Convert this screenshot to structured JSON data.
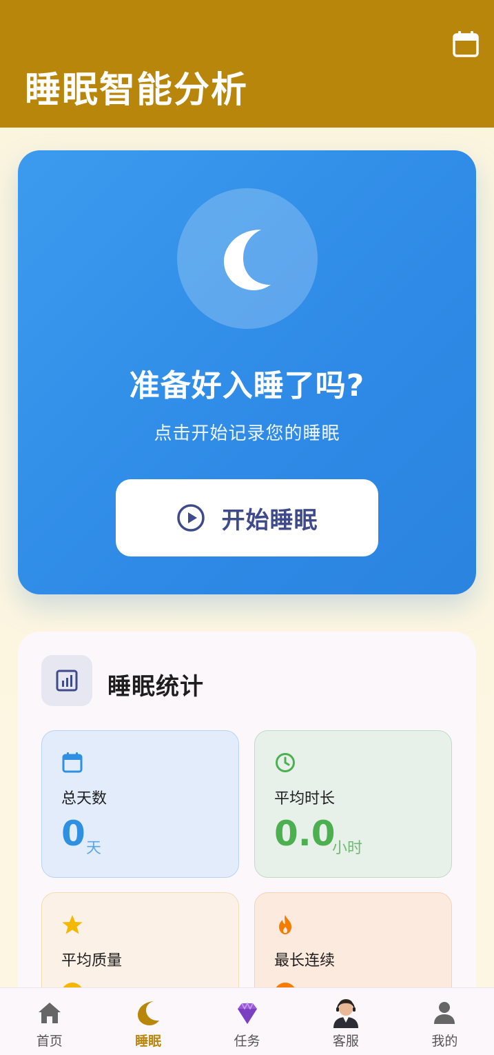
{
  "header": {
    "title": "睡眠智能分析",
    "calendar_icon": "calendar-icon",
    "bg_color": "#b8860b"
  },
  "hero": {
    "icon": "moon-icon",
    "title": "准备好入睡了吗?",
    "subtitle": "点击开始记录您的睡眠",
    "button_label": "开始睡眠",
    "button_icon": "play-circle-icon"
  },
  "stats": {
    "title": "睡眠统计",
    "icon": "bar-chart-icon",
    "tiles": [
      {
        "label": "总天数",
        "value": "0",
        "unit": "天",
        "icon": "calendar-icon",
        "color": "#2f8fe0"
      },
      {
        "label": "平均时长",
        "value": "0.0",
        "unit": "小时",
        "icon": "clock-icon",
        "color": "#4caf50"
      },
      {
        "label": "平均质量",
        "icon": "star-icon",
        "color": "#f5b800"
      },
      {
        "label": "最长连续",
        "icon": "fire-icon",
        "color": "#f57c00"
      }
    ]
  },
  "nav": {
    "items": [
      {
        "label": "首页",
        "icon": "home-icon",
        "active": false
      },
      {
        "label": "睡眠",
        "icon": "moon-icon",
        "active": true
      },
      {
        "label": "任务",
        "icon": "diamond-icon",
        "active": false
      },
      {
        "label": "客服",
        "icon": "agent-avatar-icon",
        "active": false
      },
      {
        "label": "我的",
        "icon": "user-icon",
        "active": false
      }
    ]
  }
}
